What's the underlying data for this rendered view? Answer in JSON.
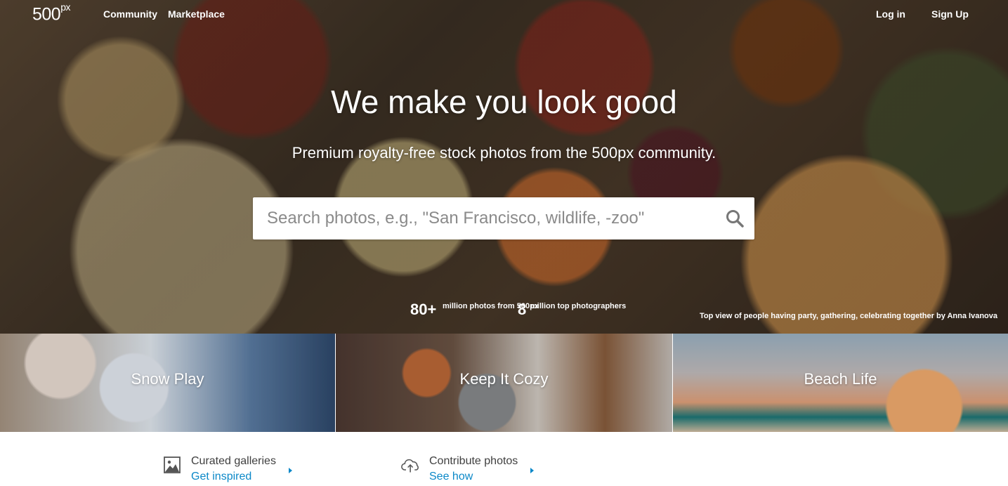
{
  "header": {
    "logo_text": "500",
    "logo_suffix": "px",
    "nav": {
      "community": "Community",
      "marketplace": "Marketplace",
      "login": "Log in",
      "signup": "Sign Up"
    }
  },
  "hero": {
    "headline": "We make you look good",
    "subheadline": "Premium royalty-free stock photos from the 500px community.",
    "search": {
      "placeholder": "Search photos, e.g., \"San Francisco, wildlife, -zoo\"",
      "value": "",
      "icon": "search-icon"
    },
    "stats": [
      {
        "number": "80+",
        "description": "million photos from 500px"
      },
      {
        "number": "8",
        "description": "million top photographers"
      }
    ],
    "photo_credit": "Top view of people having party, gathering, celebrating together by Anna Ivanova"
  },
  "categories": [
    {
      "label": "Snow Play"
    },
    {
      "label": "Keep It Cozy"
    },
    {
      "label": "Beach Life"
    }
  ],
  "features": [
    {
      "title": "Curated galleries",
      "link": "Get inspired",
      "icon": "gallery-icon"
    },
    {
      "title": "Contribute photos",
      "link": "See how",
      "icon": "cloud-upload-icon"
    }
  ],
  "colors": {
    "link": "#0b88c8",
    "text_dark": "#3f3f3f",
    "white": "#ffffff"
  }
}
